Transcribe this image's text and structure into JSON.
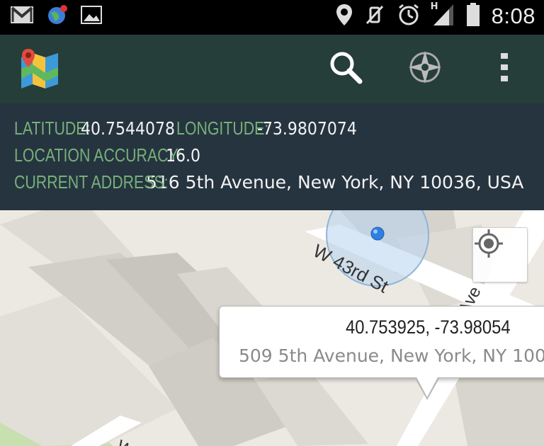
{
  "status_bar": {
    "time": "8:08",
    "network_type": "H",
    "left_icons": [
      "gmail-icon",
      "notification-globe-icon",
      "image-icon"
    ],
    "right_icons": [
      "location-pin-icon",
      "mute-icon",
      "alarm-icon",
      "signal-icon",
      "battery-icon"
    ]
  },
  "action_bar": {
    "app_icon": "maps-app-icon",
    "actions": [
      "search-icon",
      "compass-icon",
      "overflow-menu-icon"
    ]
  },
  "info": {
    "latitude_label": "LATITUDE:",
    "latitude_value": "40.7544078",
    "longitude_label": "LONGITUDE:",
    "longitude_value": "-73.9807074",
    "accuracy_label": "LOCATION ACCURACY:",
    "accuracy_value": "16.0",
    "address_label": "CURRENT ADDRESS:",
    "address_value": "516 5th Avenue, New York, NY 10036, USA"
  },
  "map": {
    "street_1": "W 43rd St",
    "street_2": "Ave",
    "street_3": "W",
    "callout_title": "40.753925, -73.98054",
    "callout_subtitle": "509 5th Avenue, New York, NY 100",
    "colors": {
      "background": "#ece9e3",
      "park": "#c8dfb0",
      "road": "#ffffff",
      "accuracy_circle": "#9ec3e6",
      "location_dot": "#2f7fe0"
    }
  }
}
